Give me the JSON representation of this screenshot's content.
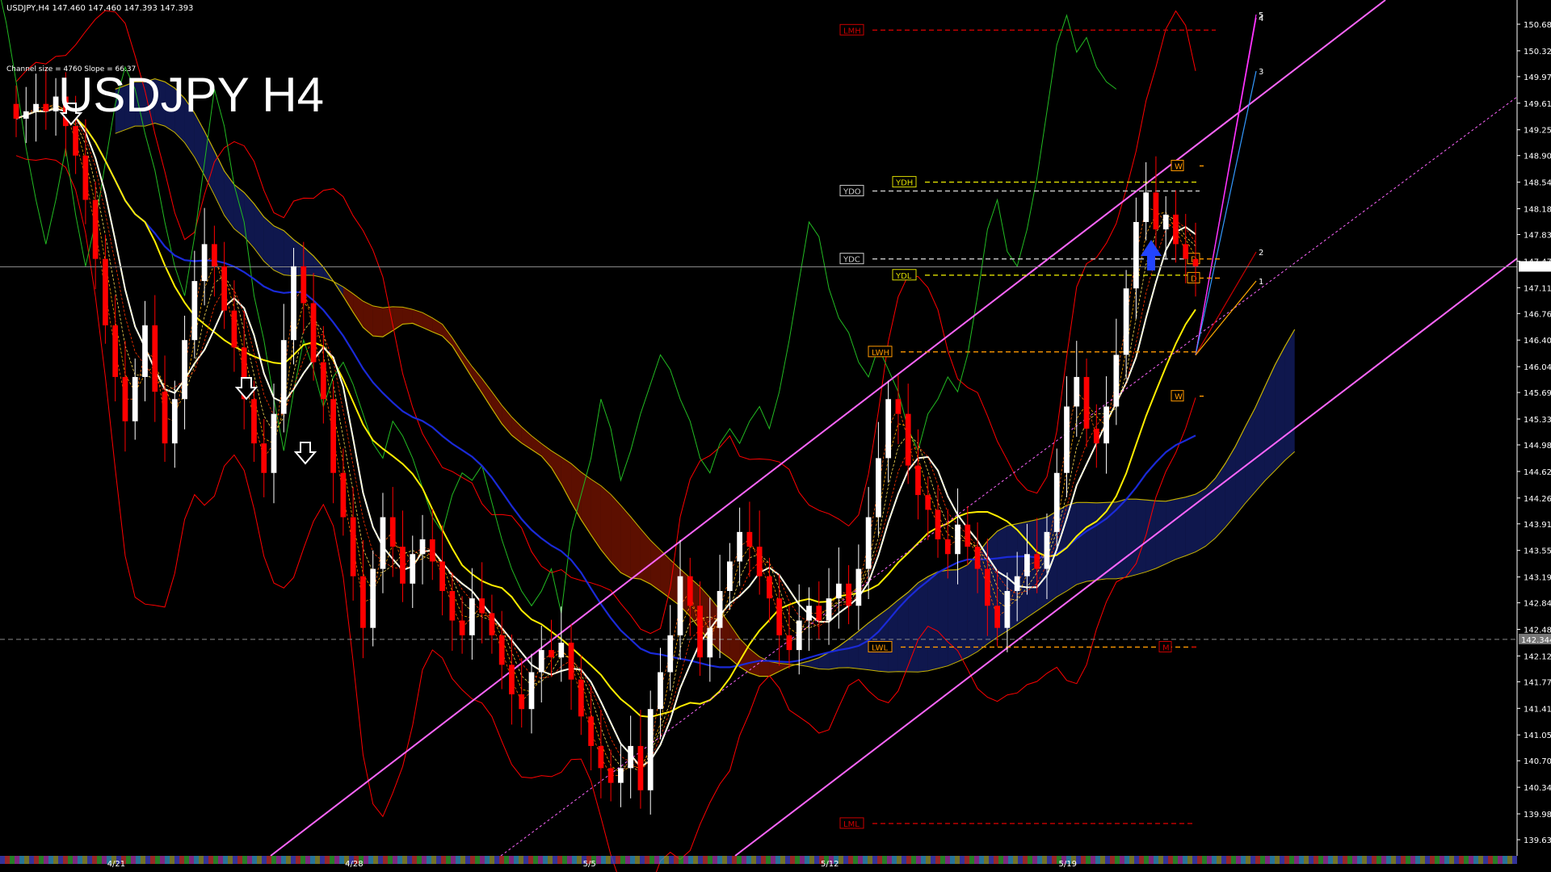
{
  "header": {
    "symbol_line": "USDJPY,H4  147.460 147.460 147.393 147.393",
    "channel_info": "Channel size = 4760 Slope = 66.37",
    "big_title": "USDJPY H4"
  },
  "colors": {
    "background": "#000000",
    "bull": "#ffffff",
    "bear": "#ff0000",
    "cloud": "#cc2200",
    "cloud_blue": "#2233aa",
    "channel": "#ff66ff",
    "ma_white": "#ffffff",
    "ma_yellow": "#ffee00",
    "ma_blue": "#1a2ad8",
    "bollinger": "#ff0000",
    "chikou": "#22bb22",
    "axis": "#ffffff"
  },
  "chart_data": {
    "type": "candlestick",
    "title": "USDJPY H4",
    "ylim": [
      139.6,
      151.0
    ],
    "y_ticks": [
      "150.680",
      "150.320",
      "149.970",
      "149.610",
      "149.250",
      "148.900",
      "148.540",
      "148.180",
      "147.830",
      "147.470",
      "147.110",
      "146.760",
      "146.400",
      "146.040",
      "145.690",
      "145.330",
      "144.980",
      "144.620",
      "144.260",
      "143.910",
      "143.550",
      "143.190",
      "142.840",
      "142.480",
      "142.120",
      "141.770",
      "141.410",
      "141.050",
      "140.700",
      "140.340",
      "139.980",
      "139.630"
    ],
    "current_price": "147.393",
    "ref_price": "142.344",
    "x_ticks": [
      "4/21",
      "4/28",
      "5/5",
      "5/12",
      "5/19"
    ],
    "closes": [
      149.4,
      149.5,
      149.6,
      149.5,
      149.7,
      149.3,
      148.9,
      148.3,
      147.5,
      146.6,
      145.9,
      145.3,
      145.9,
      146.6,
      145.7,
      145.0,
      145.6,
      146.4,
      147.2,
      147.7,
      147.4,
      146.8,
      146.3,
      145.6,
      145.0,
      144.6,
      145.4,
      146.4,
      147.4,
      146.9,
      146.1,
      145.6,
      144.6,
      144.0,
      143.2,
      142.5,
      143.3,
      144.0,
      143.6,
      143.1,
      143.5,
      143.7,
      143.4,
      143.0,
      142.6,
      142.4,
      142.9,
      142.7,
      142.4,
      142.0,
      141.6,
      141.4,
      141.9,
      142.2,
      142.1,
      142.3,
      141.8,
      141.3,
      140.9,
      140.6,
      140.4,
      140.6,
      140.9,
      140.3,
      141.4,
      141.9,
      142.4,
      143.2,
      142.8,
      142.1,
      142.5,
      143.0,
      143.4,
      143.8,
      143.6,
      143.2,
      142.9,
      142.4,
      142.2,
      142.6,
      142.8,
      142.6,
      142.9,
      143.1,
      142.8,
      143.3,
      144.0,
      144.8,
      145.6,
      145.4,
      144.7,
      144.3,
      144.1,
      143.7,
      143.5,
      143.9,
      143.6,
      143.3,
      142.8,
      142.5,
      143.0,
      143.2,
      143.5,
      143.3,
      143.8,
      144.6,
      145.5,
      145.9,
      145.2,
      145.0,
      145.5,
      146.2,
      147.1,
      148.0,
      148.4,
      147.9,
      148.1,
      147.7,
      147.5,
      147.4
    ],
    "levels": [
      {
        "label": "LMH",
        "price": 150.6
      },
      {
        "label": "YDO",
        "price": 148.42
      },
      {
        "label": "YDH",
        "price": 148.54
      },
      {
        "label": "YDC",
        "price": 147.5
      },
      {
        "label": "YDL",
        "price": 147.28
      },
      {
        "label": "LWH",
        "price": 146.24
      },
      {
        "label": "LWL",
        "price": 142.24
      },
      {
        "label": "LML",
        "price": 139.85
      },
      {
        "label": "W",
        "price": 148.76
      },
      {
        "label": "W",
        "price": 145.64
      },
      {
        "label": "D",
        "price": 147.5
      },
      {
        "label": "D",
        "price": 147.24
      },
      {
        "label": "M",
        "price": 142.24
      }
    ],
    "projection_labels": [
      "5",
      "4",
      "3",
      "2",
      "1"
    ]
  }
}
